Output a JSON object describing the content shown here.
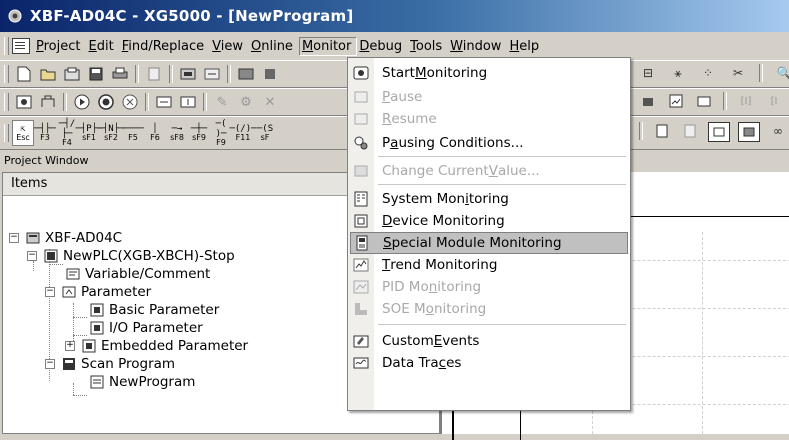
{
  "window": {
    "title": "XBF-AD04C - XG5000 - [NewProgram]"
  },
  "menubar": {
    "items": [
      {
        "id": "project",
        "pre": "",
        "mn": "P",
        "post": "roject"
      },
      {
        "id": "edit",
        "pre": "",
        "mn": "E",
        "post": "dit"
      },
      {
        "id": "find",
        "pre": "",
        "mn": "F",
        "post": "ind/Replace"
      },
      {
        "id": "view",
        "pre": "",
        "mn": "V",
        "post": "iew"
      },
      {
        "id": "online",
        "pre": "",
        "mn": "O",
        "post": "nline"
      },
      {
        "id": "monitor",
        "pre": "",
        "mn": "M",
        "post": "onitor"
      },
      {
        "id": "debug",
        "pre": "",
        "mn": "D",
        "post": "ebug"
      },
      {
        "id": "tools",
        "pre": "",
        "mn": "T",
        "post": "ools"
      },
      {
        "id": "window",
        "pre": "",
        "mn": "W",
        "post": "indow"
      },
      {
        "id": "help",
        "pre": "",
        "mn": "H",
        "post": "elp"
      }
    ]
  },
  "ladder_keys": [
    {
      "glyph": "─┤├─",
      "label": "F3"
    },
    {
      "glyph": "─┤/├─",
      "label": "F4"
    },
    {
      "glyph": "─┤P├─",
      "label": "sF1"
    },
    {
      "glyph": "─┤N├─",
      "label": "sF2"
    },
    {
      "glyph": "────",
      "label": "F5"
    },
    {
      "glyph": "│",
      "label": "F6"
    },
    {
      "glyph": "─→",
      "label": "sF8"
    },
    {
      "glyph": "─┼─",
      "label": "sF9"
    },
    {
      "glyph": "─( )─",
      "label": "F9"
    },
    {
      "glyph": "─(/)─",
      "label": "F11"
    },
    {
      "glyph": "─(S",
      "label": "sF"
    }
  ],
  "esc_key": "Esc",
  "project_window": {
    "title": "Project Window",
    "items_header": "Items",
    "tree": [
      {
        "label": "XBF-AD04C"
      },
      {
        "label": "NewPLC(XGB-XBCH)-Stop"
      },
      {
        "label": "Variable/Comment"
      },
      {
        "label": "Parameter"
      },
      {
        "label": "Basic Parameter"
      },
      {
        "label": "I/O Parameter"
      },
      {
        "label": "Embedded Parameter"
      },
      {
        "label": "Scan Program"
      },
      {
        "label": "NewProgram"
      }
    ]
  },
  "monitor_menu": {
    "items": [
      {
        "pre": "Start ",
        "mn": "M",
        "post": "onitoring",
        "disabled": false,
        "icon": "start-monitoring-icon"
      },
      {
        "pre": "",
        "mn": "P",
        "post": "ause",
        "disabled": true,
        "icon": "pause-icon"
      },
      {
        "pre": "",
        "mn": "R",
        "post": "esume",
        "disabled": true,
        "icon": "resume-icon"
      },
      {
        "pre": "P",
        "mn": "a",
        "post": "using Conditions...",
        "disabled": false,
        "icon": "pausing-conditions-icon"
      },
      {
        "pre": "Change Current ",
        "mn": "V",
        "post": "alue...",
        "disabled": true,
        "icon": "change-value-icon"
      },
      {
        "pre": "System Mon",
        "mn": "i",
        "post": "toring",
        "disabled": false,
        "icon": "system-monitoring-icon"
      },
      {
        "pre": "",
        "mn": "D",
        "post": "evice Monitoring",
        "disabled": false,
        "icon": "device-monitoring-icon"
      },
      {
        "pre": "",
        "mn": "S",
        "post": "pecial Module Monitoring",
        "disabled": false,
        "selected": true,
        "icon": "special-module-icon"
      },
      {
        "pre": "",
        "mn": "T",
        "post": "rend Monitoring",
        "disabled": false,
        "icon": "trend-monitoring-icon"
      },
      {
        "pre": "PID Mo",
        "mn": "n",
        "post": "itoring",
        "disabled": true,
        "icon": "pid-monitoring-icon"
      },
      {
        "pre": "SOE M",
        "mn": "o",
        "post": "nitoring",
        "disabled": true,
        "icon": "soe-monitoring-icon"
      },
      {
        "pre": "Custom ",
        "mn": "E",
        "post": "vents",
        "disabled": false,
        "icon": "custom-events-icon"
      },
      {
        "pre": "Data Tra",
        "mn": "c",
        "post": "es",
        "disabled": false,
        "icon": "data-traces-icon"
      }
    ]
  }
}
